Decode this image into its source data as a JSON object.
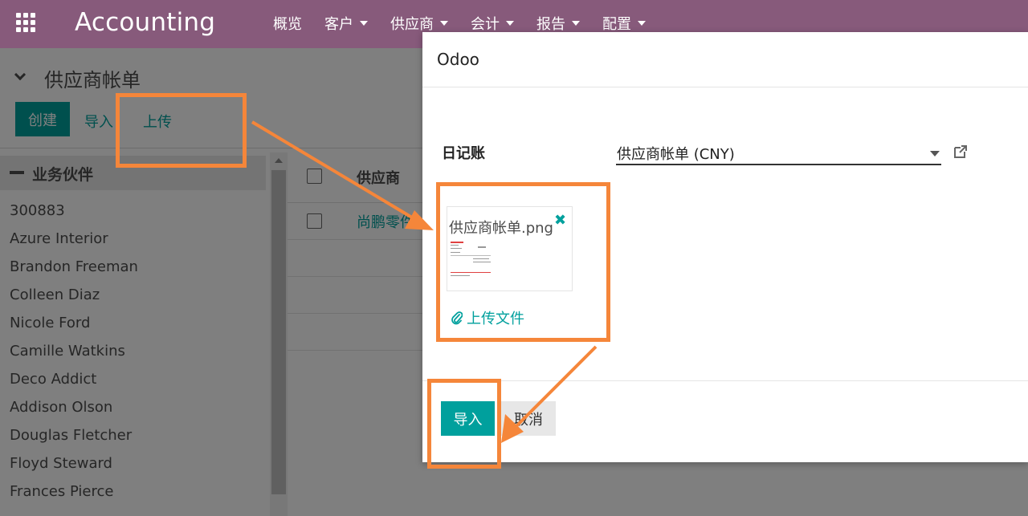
{
  "app": {
    "brand": "Accounting",
    "menu": [
      "概览",
      "客户",
      "供应商",
      "会计",
      "报告",
      "配置"
    ]
  },
  "control_panel": {
    "title": "供应商帐单",
    "create_label": "创建",
    "import_label": "导入",
    "upload_label": "上传"
  },
  "sidebar": {
    "header": "业务伙伴",
    "partners": [
      "300883",
      "Azure Interior",
      "Brandon Freeman",
      "Colleen Diaz",
      "Nicole Ford",
      "Camille Watkins",
      "Deco Addict",
      "Addison Olson",
      "Douglas Fletcher",
      "Floyd Steward",
      "Frances Pierce"
    ]
  },
  "list": {
    "column_vendor": "供应商",
    "rows": [
      {
        "vendor": "尚鹏零件"
      }
    ]
  },
  "modal": {
    "title": "Odoo",
    "journal_label": "日记账",
    "journal_value": "供应商帐单 (CNY)",
    "attachment_name": "供应商帐单.png",
    "upload_file_label": "上传文件",
    "import_button": "导入",
    "cancel_button": "取消"
  },
  "colors": {
    "nav": "#875a7b",
    "accent": "#00a09d",
    "annotation": "#f5863a"
  }
}
